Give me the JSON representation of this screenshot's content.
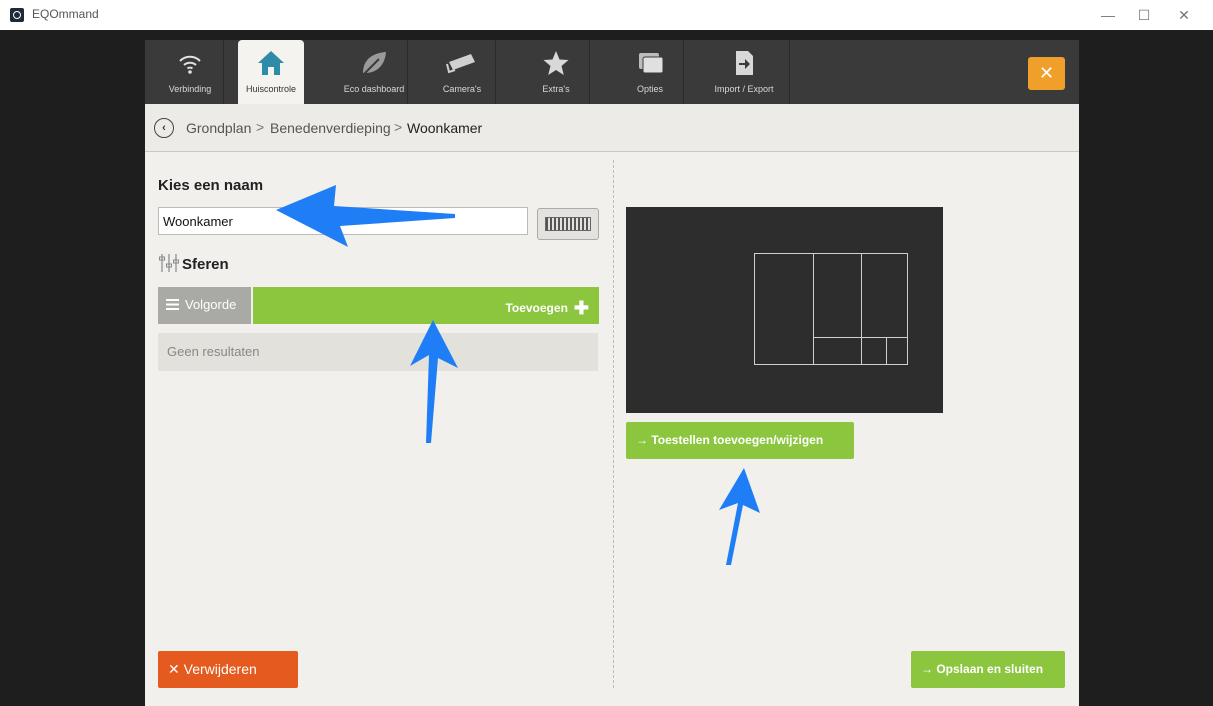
{
  "window": {
    "title": "EQOmmand",
    "controls": [
      "—",
      "☐",
      "✕"
    ]
  },
  "tabs": [
    {
      "label": "Verbinding",
      "icon": "wifi-icon",
      "active": false
    },
    {
      "label": "Huiscontrole",
      "icon": "house-icon",
      "active": true
    },
    {
      "label": "Eco dashboard",
      "icon": "leaf-icon",
      "active": false
    },
    {
      "label": "Camera's",
      "icon": "camera-icon",
      "active": false
    },
    {
      "label": "Extra's",
      "icon": "star-icon",
      "active": false
    },
    {
      "label": "Opties",
      "icon": "options-icon",
      "active": false
    },
    {
      "label": "Import / Export",
      "icon": "import-export-icon",
      "active": false
    }
  ],
  "close_label": "✕",
  "breadcrumb": {
    "back": "‹",
    "items": [
      "Grondplan",
      "Benedenverdieping",
      "Woonkamer"
    ],
    "separator": ">"
  },
  "form": {
    "name_heading": "Kies een naam",
    "name_value": "Woonkamer",
    "spheres_heading": "Sferen",
    "order_label": "Volgorde",
    "add_label": "Toevoegen",
    "no_results": "Geen resultaten",
    "delete_label": "Verwijderen"
  },
  "right": {
    "devices_label": "Toestellen toevoegen/wijzigen",
    "save_label": "Opslaan en sluiten"
  },
  "colors": {
    "green": "#8cc63f",
    "orange": "#e45a1f",
    "accent_close": "#f0a02a",
    "annotation_arrow": "#1f7ef5"
  }
}
